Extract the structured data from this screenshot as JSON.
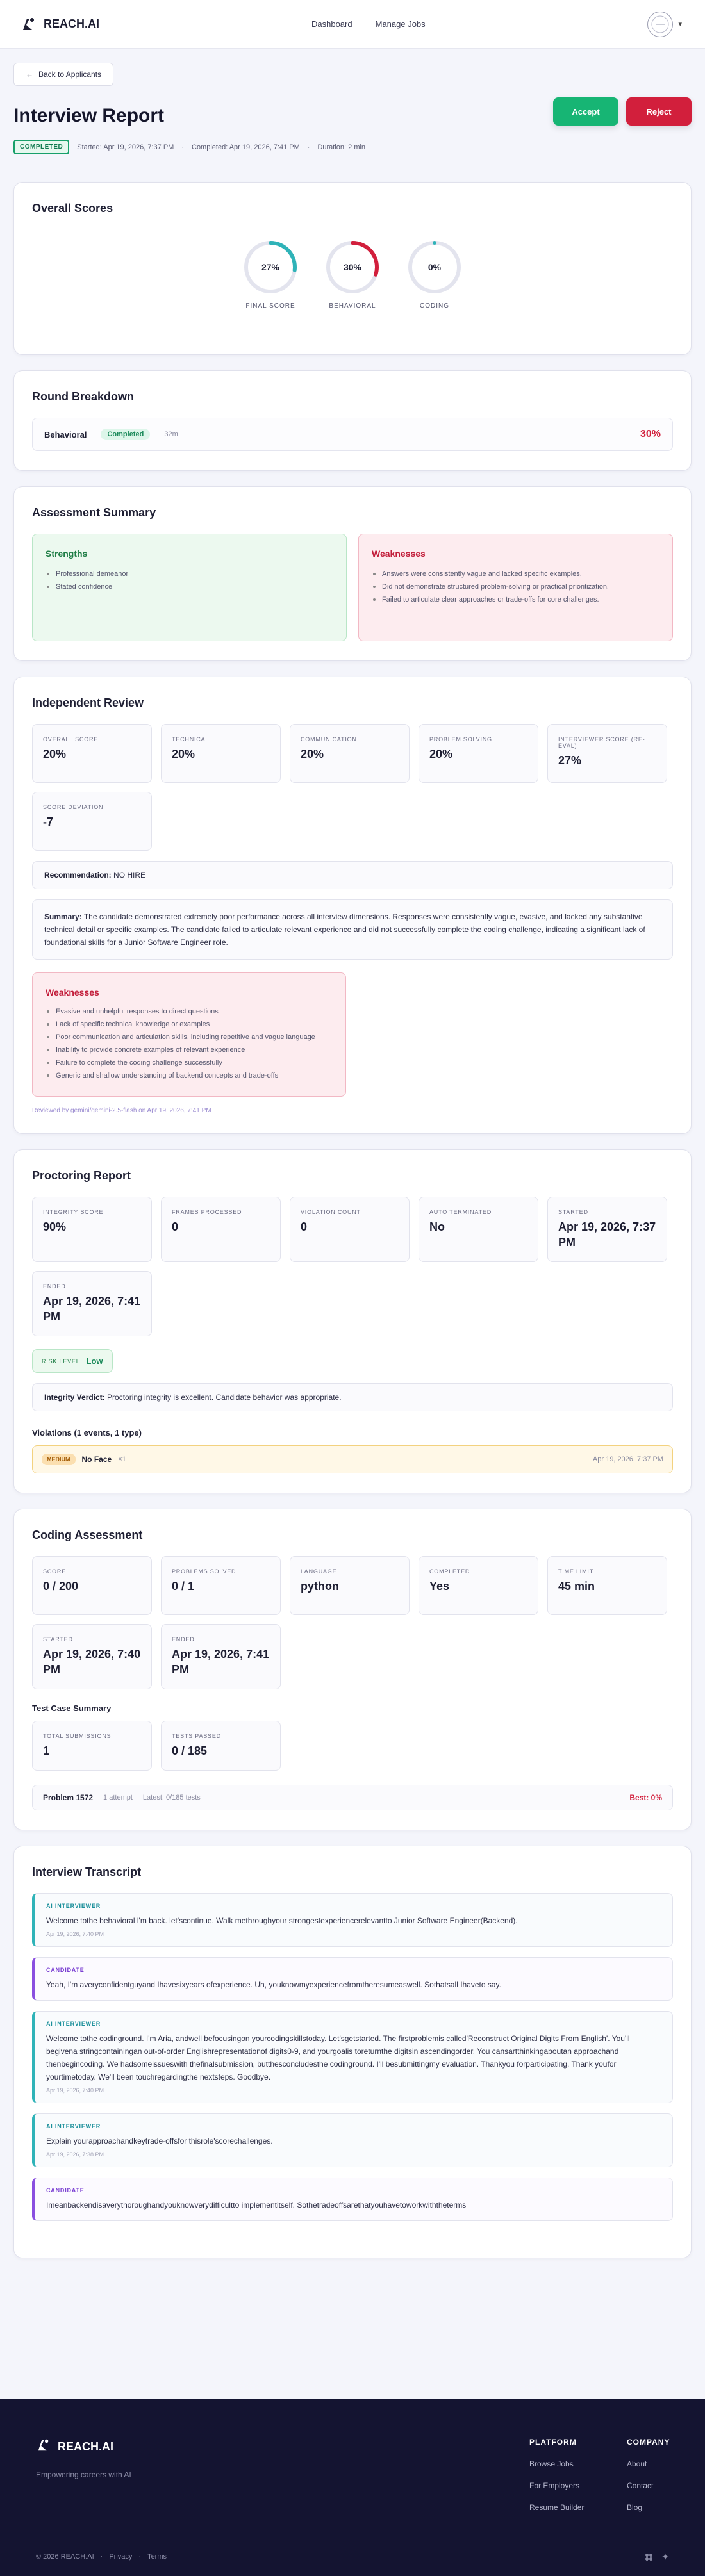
{
  "nav": {
    "brand": "REACH.AI",
    "links": [
      "Dashboard",
      "Manage Jobs"
    ]
  },
  "back_label": "Back to Applicants",
  "header": {
    "title": "Interview Report",
    "status": "COMPLETED",
    "started": "Started: Apr 19, 2026, 7:37 PM",
    "completed": "Completed: Apr 19, 2026, 7:41 PM",
    "duration": "Duration: 2 min",
    "accept": "Accept",
    "reject": "Reject"
  },
  "overall": {
    "title": "Overall Scores",
    "gauges": [
      {
        "value": 27,
        "text": "27%",
        "label": "FINAL SCORE",
        "color": "#2fb3b8"
      },
      {
        "value": 30,
        "text": "30%",
        "label": "BEHAVIORAL",
        "color": "#d21f3c"
      },
      {
        "value": 0,
        "text": "0%",
        "label": "CODING",
        "color": "#2fb3b8"
      }
    ]
  },
  "rounds": {
    "title": "Round Breakdown",
    "rows": [
      {
        "name": "Behavioral",
        "status": "Completed",
        "duration": "32m",
        "score": "30%"
      }
    ]
  },
  "assessment": {
    "title": "Assessment Summary",
    "strengths_title": "Strengths",
    "strengths": [
      "Professional demeanor",
      "Stated confidence"
    ],
    "weaknesses_title": "Weaknesses",
    "weaknesses": [
      "Answers were consistently vague and lacked specific examples.",
      "Did not demonstrate structured problem-solving or practical prioritization.",
      "Failed to articulate clear approaches or trade-offs for core challenges."
    ]
  },
  "independent": {
    "title": "Independent Review",
    "stats": [
      {
        "label": "OVERALL SCORE",
        "value": "20%"
      },
      {
        "label": "TECHNICAL",
        "value": "20%"
      },
      {
        "label": "COMMUNICATION",
        "value": "20%"
      },
      {
        "label": "PROBLEM SOLVING",
        "value": "20%"
      },
      {
        "label": "INTERVIEWER SCORE (RE-EVAL)",
        "value": "27%"
      },
      {
        "label": "SCORE DEVIATION",
        "value": "-7"
      }
    ],
    "recommendation_label": "Recommendation:",
    "recommendation": "NO HIRE",
    "summary_label": "Summary:",
    "summary": "The candidate demonstrated extremely poor performance across all interview dimensions. Responses were consistently vague, evasive, and lacked any substantive technical detail or specific examples. The candidate failed to articulate relevant experience and did not successfully complete the coding challenge, indicating a significant lack of foundational skills for a Junior Software Engineer role.",
    "weaknesses_title": "Weaknesses",
    "weaknesses": [
      "Evasive and unhelpful responses to direct questions",
      "Lack of specific technical knowledge or examples",
      "Poor communication and articulation skills, including repetitive and vague language",
      "Inability to provide concrete examples of relevant experience",
      "Failure to complete the coding challenge successfully",
      "Generic and shallow understanding of backend concepts and trade-offs"
    ],
    "reviewed": "Reviewed by gemini/gemini-2.5-flash on Apr 19, 2026, 7:41 PM"
  },
  "proctoring": {
    "title": "Proctoring Report",
    "stats": [
      {
        "label": "INTEGRITY SCORE",
        "value": "90%"
      },
      {
        "label": "FRAMES PROCESSED",
        "value": "0"
      },
      {
        "label": "VIOLATION COUNT",
        "value": "0"
      },
      {
        "label": "AUTO TERMINATED",
        "value": "No"
      },
      {
        "label": "STARTED",
        "value": "Apr 19, 2026, 7:37 PM"
      },
      {
        "label": "ENDED",
        "value": "Apr 19, 2026, 7:41 PM"
      }
    ],
    "risk_label": "RISK LEVEL",
    "risk_value": "Low",
    "verdict_label": "Integrity Verdict:",
    "verdict": "Proctoring integrity is excellent. Candidate behavior was appropriate.",
    "violations_title": "Violations (1 events, 1 type)",
    "violations": [
      {
        "severity": "MEDIUM",
        "type": "No Face",
        "count": "×1",
        "time": "Apr 19, 2026, 7:37 PM"
      }
    ]
  },
  "coding": {
    "title": "Coding Assessment",
    "stats": [
      {
        "label": "SCORE",
        "value": "0 / 200"
      },
      {
        "label": "PROBLEMS SOLVED",
        "value": "0 / 1"
      },
      {
        "label": "LANGUAGE",
        "value": "python"
      },
      {
        "label": "COMPLETED",
        "value": "Yes"
      },
      {
        "label": "TIME LIMIT",
        "value": "45 min"
      },
      {
        "label": "STARTED",
        "value": "Apr 19, 2026, 7:40 PM"
      },
      {
        "label": "ENDED",
        "value": "Apr 19, 2026, 7:41 PM"
      }
    ],
    "test_summary_title": "Test Case Summary",
    "test_stats": [
      {
        "label": "TOTAL SUBMISSIONS",
        "value": "1"
      },
      {
        "label": "TESTS PASSED",
        "value": "0 / 185"
      }
    ],
    "problem": {
      "name": "Problem 1572",
      "attempts": "1 attempt",
      "latest": "Latest: 0/185 tests",
      "best": "Best: 0%"
    }
  },
  "transcript": {
    "title": "Interview Transcript",
    "messages": [
      {
        "role": "AI INTERVIEWER",
        "kind": "ai",
        "text": "Welcome tothe behavioral l'm back. let'scontinue. Walk methroughyour strongestexperiencerelevantto Junior Software Engineer(Backend).",
        "time": "Apr 19, 2026, 7:40 PM"
      },
      {
        "role": "CANDIDATE",
        "kind": "cand",
        "text": "Yeah, I'm averyconfidentguyand Ihavesixyears ofexperience. Uh, youknowmyexperiencefromtheresumeaswell. Sothatsall Ihaveto say.",
        "time": ""
      },
      {
        "role": "AI INTERVIEWER",
        "kind": "ai",
        "text": "Welcome tothe codinground. I'm Aria, andwell befocusingon yourcodingskillstoday. Let'sgetstarted. The firstproblemis called'Reconstruct Original Digits From English'. You'll begivena stringcontainingan out-of-order Englishrepresentationof digits0-9, and yourgoalis toreturnthe digitsin ascendingorder. You cansartthinkingaboutan approachand thenbegincoding. We hadsomeissueswith thefinalsubmission, butthesconcludesthe codinground. I'll besubmittingmy evaluation. Thankyou forparticipating. Thank youfor yourtimetoday. We'll been touchregardingthe nextsteps. Goodbye.",
        "time": "Apr 19, 2026, 7:40 PM"
      },
      {
        "role": "AI INTERVIEWER",
        "kind": "ai",
        "text": "Explain yourapproachandkeytrade-offsfor thisrole'scorechallenges.",
        "time": "Apr 19, 2026, 7:38 PM"
      },
      {
        "role": "CANDIDATE",
        "kind": "cand",
        "text": "Imeanbackendisaverythoroughandyouknowverydifficultto implementitself. Sothetradeoffsarethatyouhavetoworkwiththeterms",
        "time": ""
      }
    ]
  },
  "footer": {
    "brand": "REACH.AI",
    "tagline": "Empowering careers with AI",
    "platform_title": "PLATFORM",
    "platform_links": [
      "Browse Jobs",
      "For Employers",
      "Resume Builder"
    ],
    "company_title": "COMPANY",
    "company_links": [
      "About",
      "Contact",
      "Blog"
    ],
    "copyright": "© 2026 REACH.AI",
    "privacy": "Privacy",
    "terms": "Terms"
  }
}
